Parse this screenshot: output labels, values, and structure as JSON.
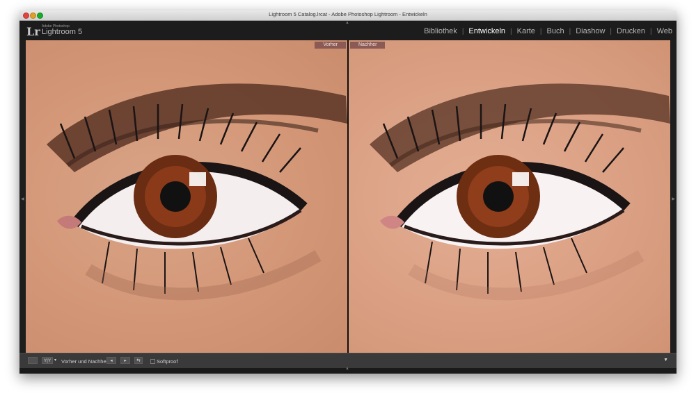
{
  "window": {
    "title": "Lightroom 5 Catalog.lrcat - Adobe Photoshop Lightroom - Entwickeln"
  },
  "app": {
    "logo_mark": "Lr",
    "vendor": "Adobe Photoshop",
    "name": "Lightroom 5"
  },
  "modules": [
    {
      "label": "Bibliothek",
      "active": false
    },
    {
      "label": "Entwickeln",
      "active": true
    },
    {
      "label": "Karte",
      "active": false
    },
    {
      "label": "Buch",
      "active": false
    },
    {
      "label": "Diashow",
      "active": false
    },
    {
      "label": "Drucken",
      "active": false
    },
    {
      "label": "Web",
      "active": false
    }
  ],
  "module_separator": "|",
  "view": {
    "before_label": "Vorher",
    "after_label": "Nachher"
  },
  "toolbar": {
    "view_mode_label": "Y|Y",
    "before_after_label": "Vorher und Nachher:",
    "softproof_label": "Softproof",
    "softproof_checked": false
  },
  "icons": {
    "collapse_top": "triangle-up-icon",
    "collapse_left": "triangle-left-icon",
    "collapse_right": "triangle-right-icon",
    "collapse_bottom": "triangle-up-icon",
    "loupe": "loupe-view-icon",
    "copy_left": "copy-settings-left-icon",
    "copy_right": "copy-settings-right-icon",
    "swap": "swap-icon",
    "toolbar_menu": "chevron-down-icon"
  },
  "colors": {
    "active_module": "#ffffff",
    "inactive_module": "#b4b4b4",
    "label_tag": "#8b5a55"
  }
}
